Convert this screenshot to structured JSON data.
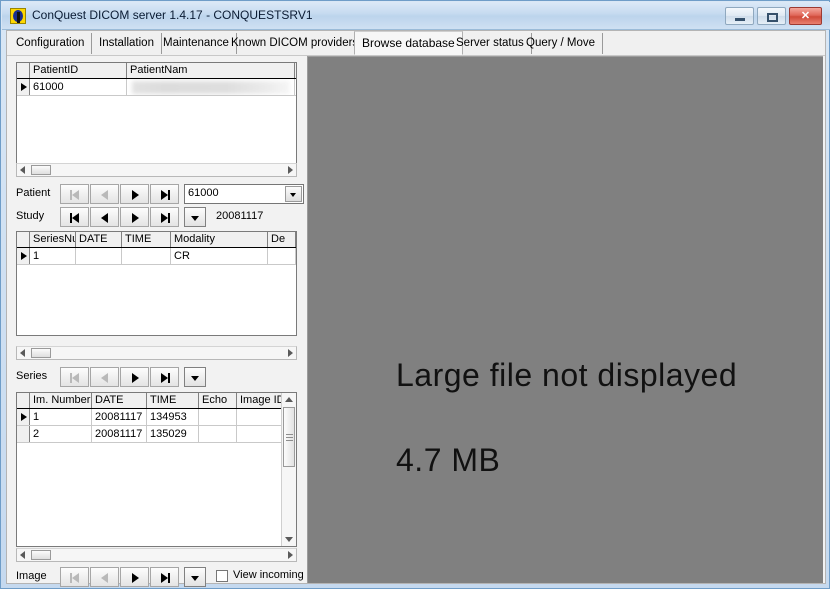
{
  "window": {
    "title": "ConQuest DICOM server 1.4.17 - CONQUESTSRV1",
    "icon": "conquest-app-icon",
    "controls": {
      "minimize": "minimize-button",
      "maximize": "maximize-button",
      "close_label": "✕"
    }
  },
  "tabs": [
    {
      "label": "Configuration",
      "active": false
    },
    {
      "label": "Installation",
      "active": false
    },
    {
      "label": "Maintenance",
      "active": false
    },
    {
      "label": "Known DICOM providers",
      "active": false
    },
    {
      "label": "Browse database",
      "active": true
    },
    {
      "label": "Server status",
      "active": false
    },
    {
      "label": "Query / Move",
      "active": false
    }
  ],
  "patient_grid": {
    "columns": [
      "PatientID",
      "PatientNam"
    ],
    "rows": [
      {
        "selected": true,
        "PatientID": "61000",
        "PatientNam": ""
      }
    ]
  },
  "patient_nav": {
    "label": "Patient",
    "buttons": [
      "first",
      "previous",
      "next",
      "last"
    ],
    "combo_value": "61000"
  },
  "study_nav": {
    "label": "Study",
    "buttons": [
      "first",
      "previous",
      "next",
      "last"
    ],
    "value": "20081117"
  },
  "series_grid": {
    "columns": [
      "SeriesNu",
      "DATE",
      "TIME",
      "Modality",
      "De"
    ],
    "rows": [
      {
        "selected": true,
        "SeriesNu": "1",
        "DATE": "",
        "TIME": "",
        "Modality": "CR",
        "De": ""
      }
    ]
  },
  "series_nav": {
    "label": "Series",
    "buttons": [
      "first",
      "previous",
      "next",
      "last"
    ]
  },
  "image_grid": {
    "columns": [
      "Im. Number",
      "DATE",
      "TIME",
      "Echo",
      "Image ID"
    ],
    "rows": [
      {
        "selected": true,
        "Im. Number": "1",
        "DATE": "20081117",
        "TIME": "134953",
        "Echo": "",
        "Image ID": ""
      },
      {
        "selected": false,
        "Im. Number": "2",
        "DATE": "20081117",
        "TIME": "135029",
        "Echo": "",
        "Image ID": ""
      }
    ]
  },
  "image_nav": {
    "label": "Image",
    "buttons": [
      "first",
      "previous",
      "next",
      "last"
    ],
    "view_incoming_label": "View incoming",
    "view_incoming_checked": false
  },
  "viewer": {
    "message": "Large file not displayed",
    "size": "4.7 MB",
    "background": "#808080"
  }
}
